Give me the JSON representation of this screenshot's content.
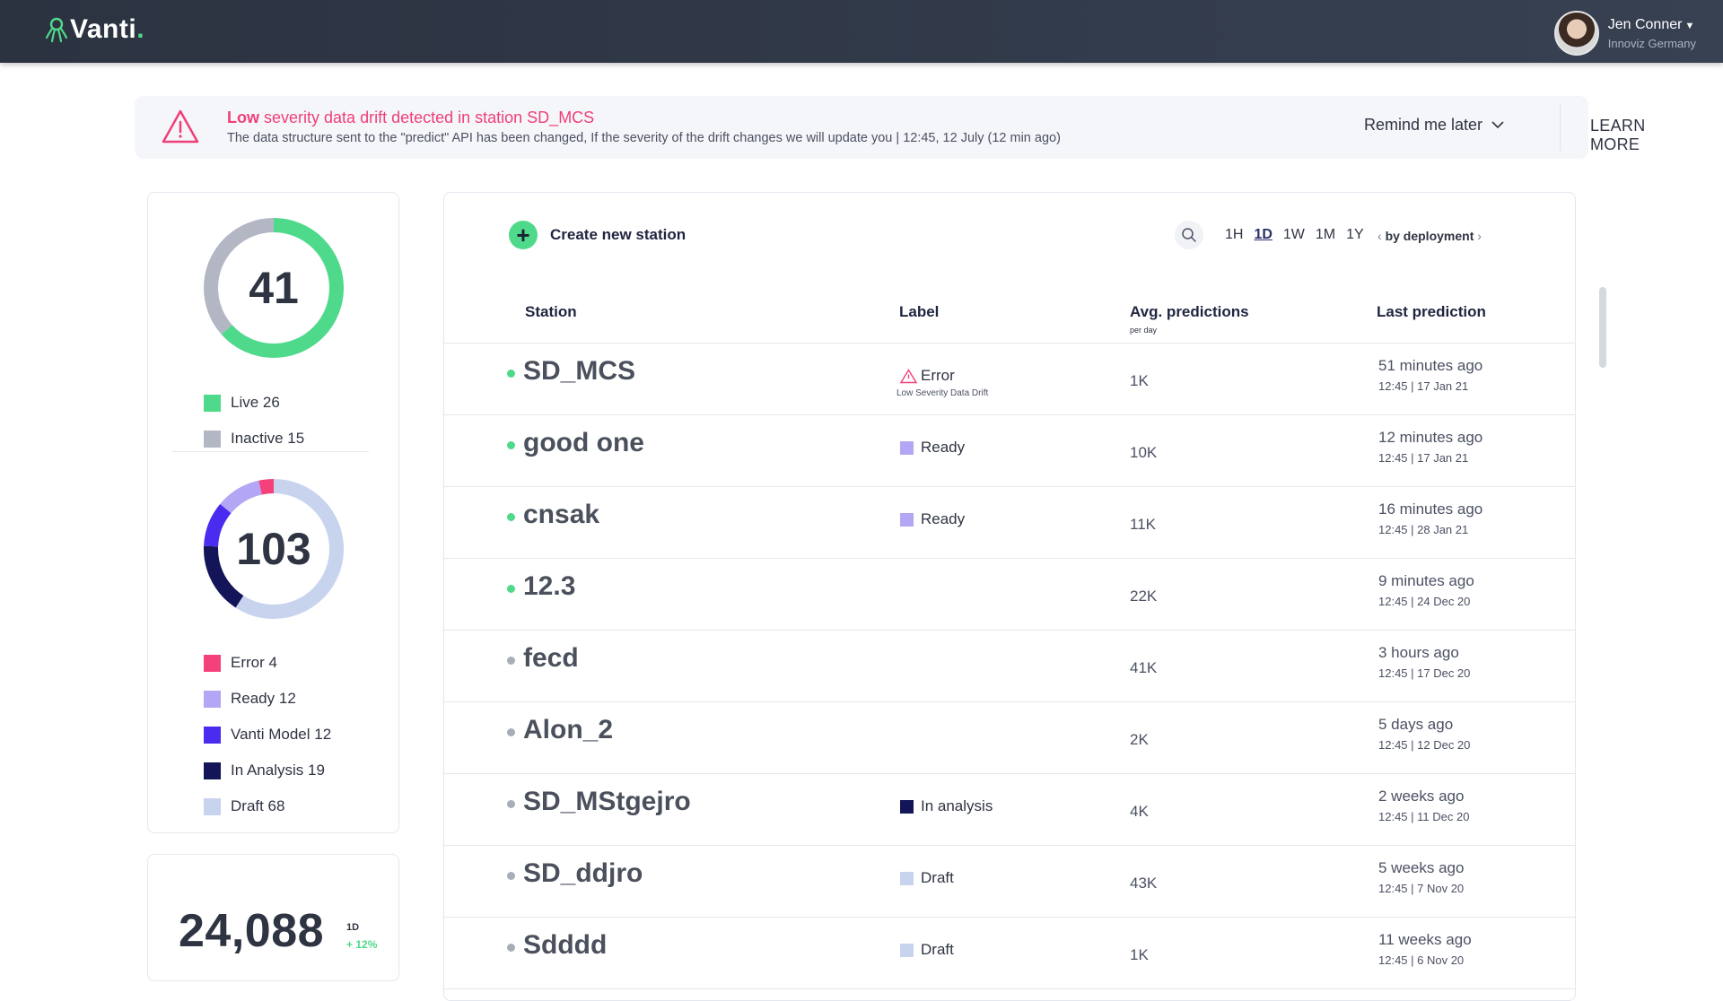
{
  "header": {
    "logo_text": "Vanti",
    "logo_dot": ".",
    "user_name": "Jen Conner",
    "user_org": "Innoviz Germany"
  },
  "alert": {
    "severity": "Low",
    "title_rest": "severity data drift detected in station SD_MCS",
    "description": "The data structure sent to the \"predict\" API has been changed, If the severity of the drift changes we will update you | 12:45, 12 July (12 min ago)",
    "remind_label": "Remind me later",
    "learn_label": "LEARN MORE"
  },
  "summary": {
    "stations_total": "41",
    "status_legend": [
      {
        "label": "Live  26",
        "color": "#4fd98b",
        "value": 26
      },
      {
        "label": "Inactive 15",
        "color": "#b3b7c4",
        "value": 15
      }
    ],
    "models_total": "103",
    "model_legend": [
      {
        "label": "Error 4",
        "color": "#f4417a",
        "value": 4
      },
      {
        "label": "Ready 12",
        "color": "#b2a6f5",
        "value": 12
      },
      {
        "label": "Vanti Model 12",
        "color": "#4a2cf0",
        "value": 12
      },
      {
        "label": "In Analysis 19",
        "color": "#131558",
        "value": 19
      },
      {
        "label": "Draft 68",
        "color": "#c8d3ee",
        "value": 68
      }
    ],
    "predictions_total": "24,088",
    "predictions_period": "1D",
    "predictions_delta": "+ 12%"
  },
  "toolbar": {
    "create_label": "Create new station",
    "ranges": [
      "1H",
      "1D",
      "1W",
      "1M",
      "1Y"
    ],
    "active_range": "1D",
    "group_label": "by deployment"
  },
  "table": {
    "columns": {
      "station": "Station",
      "label": "Label",
      "predictions": "Avg. predictions",
      "predictions_sub": "per day",
      "last": "Last prediction"
    },
    "rows": [
      {
        "name": "SD_MCS",
        "live": true,
        "label": "Error",
        "label_type": "error",
        "label_sub": "Low Severity Data Drift",
        "preds": "1K",
        "last_rel": "51 minutes ago",
        "last_abs": "12:45 | 17 Jan 21"
      },
      {
        "name": "good one",
        "live": true,
        "label": "Ready",
        "label_type": "ready",
        "label_sub": "",
        "preds": "10K",
        "last_rel": "12 minutes ago",
        "last_abs": "12:45 | 17 Jan 21"
      },
      {
        "name": "cnsak",
        "live": true,
        "label": "Ready",
        "label_type": "ready",
        "label_sub": "",
        "preds": "11K",
        "last_rel": "16 minutes ago",
        "last_abs": "12:45 | 28 Jan 21"
      },
      {
        "name": "12.3",
        "live": true,
        "label": "",
        "label_type": "none",
        "label_sub": "",
        "preds": "22K",
        "last_rel": "9 minutes ago",
        "last_abs": "12:45 | 24 Dec 20"
      },
      {
        "name": "fecd",
        "live": false,
        "label": "",
        "label_type": "none",
        "label_sub": "",
        "preds": "41K",
        "last_rel": "3 hours ago",
        "last_abs": "12:45 | 17 Dec 20"
      },
      {
        "name": "Alon_2",
        "live": false,
        "label": "",
        "label_type": "none",
        "label_sub": "",
        "preds": "2K",
        "last_rel": "5 days ago",
        "last_abs": "12:45 | 12 Dec 20"
      },
      {
        "name": "SD_MStgejro",
        "live": false,
        "label": "In analysis",
        "label_type": "analysis",
        "label_sub": "",
        "preds": "4K",
        "last_rel": "2 weeks ago",
        "last_abs": "12:45 | 11 Dec 20"
      },
      {
        "name": "SD_ddjro",
        "live": false,
        "label": "Draft",
        "label_type": "draft",
        "label_sub": "",
        "preds": "43K",
        "last_rel": "5 weeks ago",
        "last_abs": "12:45 | 7 Nov 20"
      },
      {
        "name": "Sdddd",
        "live": false,
        "label": "Draft",
        "label_type": "draft",
        "label_sub": "",
        "preds": "1K",
        "last_rel": "11 weeks ago",
        "last_abs": "12:45 | 6 Nov 20"
      }
    ]
  },
  "colors": {
    "live_dot": "#4fd98b",
    "inactive_dot": "#a9adb8",
    "error": "#f4417a",
    "ready": "#b2a6f5",
    "analysis": "#131558",
    "draft": "#c8d3ee"
  }
}
